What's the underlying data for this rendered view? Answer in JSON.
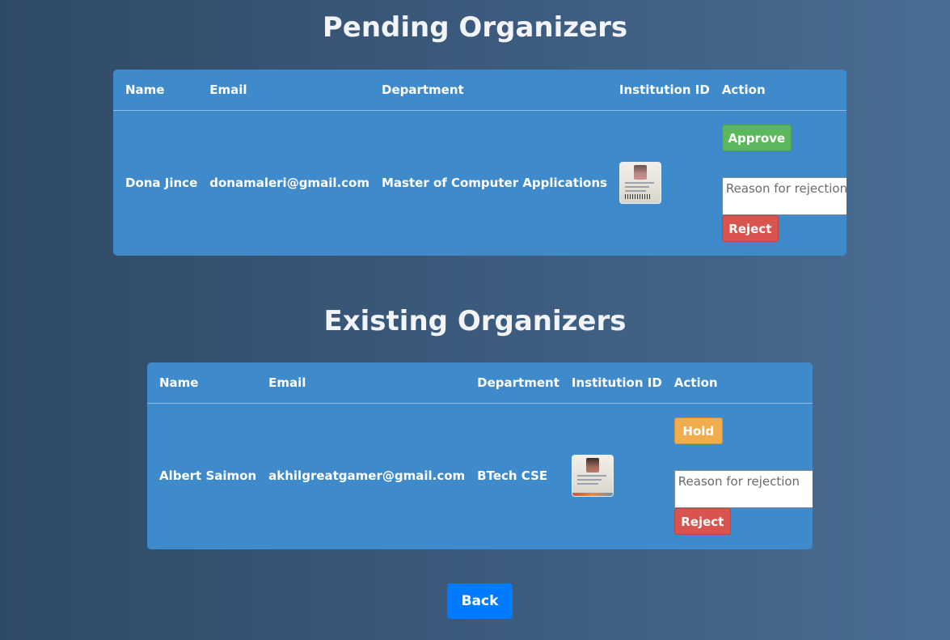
{
  "pending": {
    "title": "Pending Organizers",
    "headers": {
      "name": "Name",
      "email": "Email",
      "department": "Department",
      "institution_id": "Institution ID",
      "action": "Action"
    },
    "rows": [
      {
        "name": "Dona Jince",
        "email": "donamaleri@gmail.com",
        "department": "Master of Computer Applications",
        "id_image": "institution-id-card-thumbnail",
        "approve_label": "Approve",
        "reason_placeholder": "Reason for rejection",
        "reject_label": "Reject"
      }
    ]
  },
  "existing": {
    "title": "Existing Organizers",
    "headers": {
      "name": "Name",
      "email": "Email",
      "department": "Department",
      "institution_id": "Institution ID",
      "action": "Action"
    },
    "rows": [
      {
        "name": "Albert Saimon",
        "email": "akhilgreatgamer@gmail.com",
        "department": "BTech CSE",
        "id_image": "institution-id-card-thumbnail",
        "hold_label": "Hold",
        "reason_placeholder": "Reason for rejection",
        "reject_label": "Reject"
      }
    ]
  },
  "back_label": "Back",
  "colors": {
    "table_bg": "#3f8acb",
    "approve": "#5cb85c",
    "hold": "#f0ad4e",
    "reject": "#d9534f",
    "back": "#007bff"
  }
}
